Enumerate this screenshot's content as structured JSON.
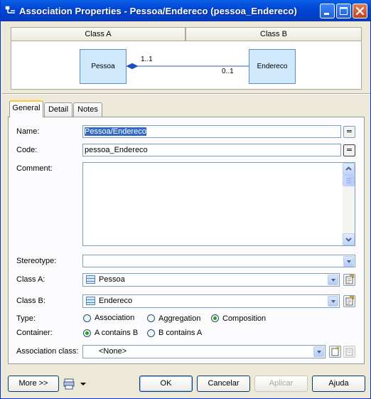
{
  "window": {
    "title": "Association Properties - Pessoa/Endereco (pessoa_Endereco)"
  },
  "header": {
    "class_a_label": "Class A",
    "class_b_label": "Class B"
  },
  "diagram": {
    "class_a": "Pessoa",
    "class_b": "Endereco",
    "mult_a": "1..1",
    "mult_b": "0..1"
  },
  "tabs": [
    {
      "label": "General",
      "active": true
    },
    {
      "label": "Detail",
      "active": false
    },
    {
      "label": "Notes",
      "active": false
    }
  ],
  "form": {
    "name_label": "Name:",
    "name_value": "Pessoa/Endereco",
    "code_label": "Code:",
    "code_value": "pessoa_Endereco",
    "comment_label": "Comment:",
    "comment_value": "",
    "stereotype_label": "Stereotype:",
    "stereotype_value": "",
    "class_a_label": "Class A:",
    "class_a_value": "Pessoa",
    "class_b_label": "Class B:",
    "class_b_value": "Endereco",
    "type_label": "Type:",
    "type_options": [
      "Association",
      "Aggregation",
      "Composition"
    ],
    "type_selected": "Composition",
    "container_label": "Container:",
    "container_options": [
      "A contains B",
      "B contains A"
    ],
    "container_selected": "A contains B",
    "association_class_label": "Association class:",
    "association_class_value": "<None>",
    "equals_glyph": "="
  },
  "buttons": {
    "more": "More >>",
    "ok": "OK",
    "cancel": "Cancelar",
    "apply": "Aplicar",
    "help": "Ajuda"
  },
  "colors": {
    "titlebar": "#0046D5",
    "class_fill": "#D0E8FC",
    "selection": "#316AC5",
    "dialog_bg": "#ECE9D8"
  }
}
